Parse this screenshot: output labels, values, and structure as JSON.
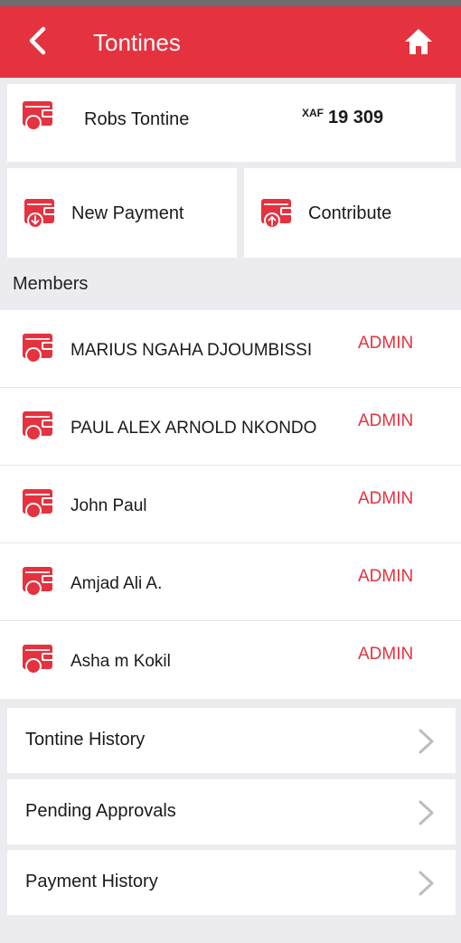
{
  "appbar": {
    "title": "Tontines",
    "back_icon": "back-arrow-icon",
    "home_icon": "home-icon",
    "color": "#e5323f"
  },
  "tontine": {
    "name": "Robs Tontine",
    "currency": "XAF",
    "amount": "19 309"
  },
  "actions": {
    "new_payment": "New Payment",
    "contribute": "Contribute"
  },
  "members": {
    "header": "Members",
    "list": [
      {
        "name": "MARIUS NGAHA DJOUMBISSI",
        "role": "ADMIN"
      },
      {
        "name": "PAUL ALEX ARNOLD NKONDO",
        "role": "ADMIN"
      },
      {
        "name": "John Paul",
        "role": "ADMIN"
      },
      {
        "name": "Amjad Ali A.",
        "role": "ADMIN"
      },
      {
        "name": "Asha m Kokil",
        "role": "ADMIN"
      }
    ]
  },
  "menu": {
    "tontine_history": "Tontine History",
    "pending_approvals": "Pending Approvals",
    "payment_history": "Payment History"
  }
}
